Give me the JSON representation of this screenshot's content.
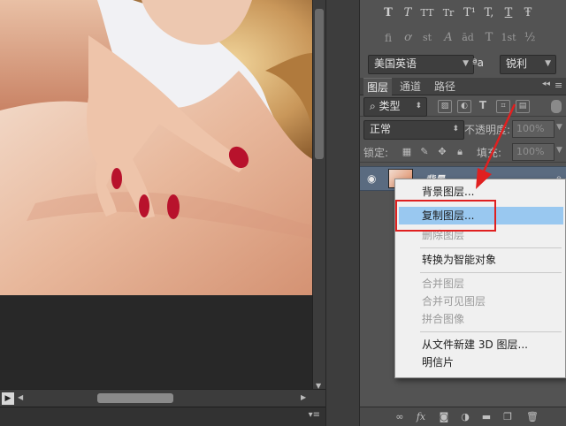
{
  "typography": {
    "style_buttons": [
      "T",
      "T",
      "TT",
      "Tr",
      "T¹",
      "T,",
      "T",
      "Ŧ"
    ],
    "opentype_buttons": [
      "fi",
      "ơ",
      "st",
      "A",
      "ād",
      "T",
      "1st",
      "½"
    ],
    "language": "美国英语",
    "aa_icon": "ªa",
    "antialias": "锐利"
  },
  "panel": {
    "tabs": [
      "图层",
      "通道",
      "路径"
    ],
    "kind": "类型",
    "blend_mode": "正常",
    "opacity_label": "不透明度:",
    "opacity_value": "100%",
    "lock_label": "锁定:",
    "fill_label": "填充:",
    "fill_value": "100%"
  },
  "layer": {
    "name": "背景"
  },
  "context_menu": {
    "items": [
      {
        "label": "背景图层...",
        "enabled": true
      },
      {
        "label": "复制图层...",
        "enabled": true,
        "highlighted": true
      },
      {
        "label": "删除图层",
        "enabled": false
      },
      {
        "label": "转换为智能对象",
        "enabled": true
      },
      {
        "label": "合并图层",
        "enabled": false
      },
      {
        "label": "合并可见图层",
        "enabled": false
      },
      {
        "label": "拼合图像",
        "enabled": false
      },
      {
        "label": "从文件新建 3D 图层...",
        "enabled": true
      },
      {
        "label": "明信片",
        "enabled": true
      }
    ]
  },
  "colors": {
    "highlight": "#99c8f0",
    "annotation_red": "#e02020",
    "selected_layer": "#5a6b80"
  }
}
